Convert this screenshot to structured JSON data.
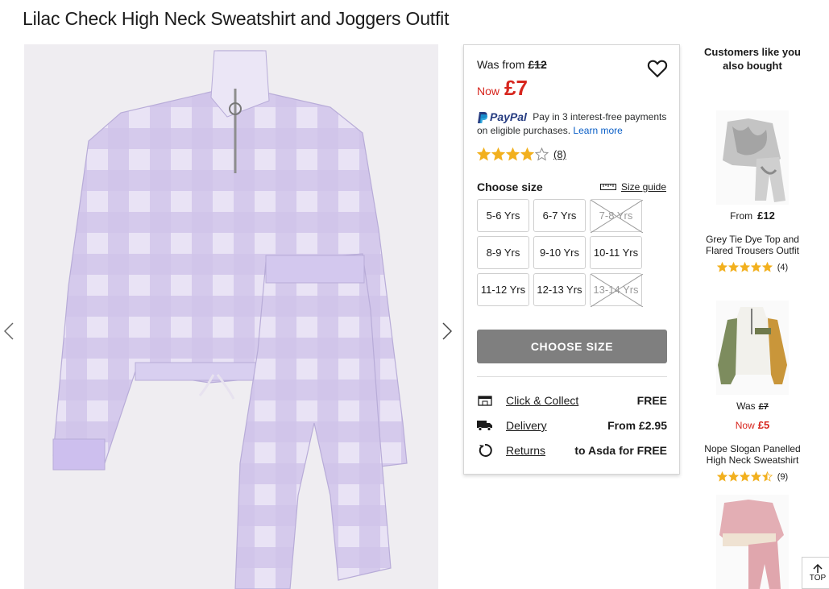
{
  "product": {
    "title": "Lilac Check High Neck Sweatshirt and Joggers Outfit"
  },
  "price": {
    "was_label": "Was from",
    "was_value": "£12",
    "now_label": "Now",
    "now_value": "£7"
  },
  "paypal": {
    "brand": "PayPal",
    "text": "Pay in 3 interest-free payments on eligible purchases.",
    "link": "Learn more"
  },
  "rating": {
    "stars": 4,
    "count": "(8)"
  },
  "size": {
    "heading": "Choose size",
    "guide_label": "Size guide",
    "options": [
      {
        "label": "5-6 Yrs",
        "available": true
      },
      {
        "label": "6-7 Yrs",
        "available": true
      },
      {
        "label": "7-8 Yrs",
        "available": false
      },
      {
        "label": "8-9 Yrs",
        "available": true
      },
      {
        "label": "9-10 Yrs",
        "available": true
      },
      {
        "label": "10-11 Yrs",
        "available": true
      },
      {
        "label": "11-12 Yrs",
        "available": true
      },
      {
        "label": "12-13 Yrs",
        "available": true
      },
      {
        "label": "13-14 Yrs",
        "available": false
      }
    ],
    "button": "CHOOSE SIZE"
  },
  "services": [
    {
      "icon": "store-icon",
      "label": "Click & Collect",
      "value": "FREE"
    },
    {
      "icon": "truck-icon",
      "label": "Delivery",
      "value": "From £2.95"
    },
    {
      "icon": "return-icon",
      "label": "Returns",
      "value": "to Asda for FREE"
    }
  ],
  "recommendations": {
    "title": "Customers like you also bought",
    "items": [
      {
        "name": "Grey Tie Dye Top and Flared Trousers Outfit",
        "price_label": "From",
        "price": "£12",
        "stars": 5,
        "count": "(4)"
      },
      {
        "name": "Nope Slogan Panelled High Neck Sweatshirt",
        "was_label": "Was",
        "was": "£7",
        "now_label": "Now",
        "now": "£5",
        "stars": 4.5,
        "count": "(9)"
      },
      {
        "name": "",
        "stars": 0
      }
    ]
  },
  "nav": {
    "top_label": "TOP"
  },
  "colors": {
    "sale_red": "#d7261e",
    "star_gold": "#f2b01e",
    "button_grey": "#7f7f7f",
    "paypal_dark": "#253b80",
    "paypal_light": "#179bd7",
    "lilac": "#c9bde6"
  }
}
